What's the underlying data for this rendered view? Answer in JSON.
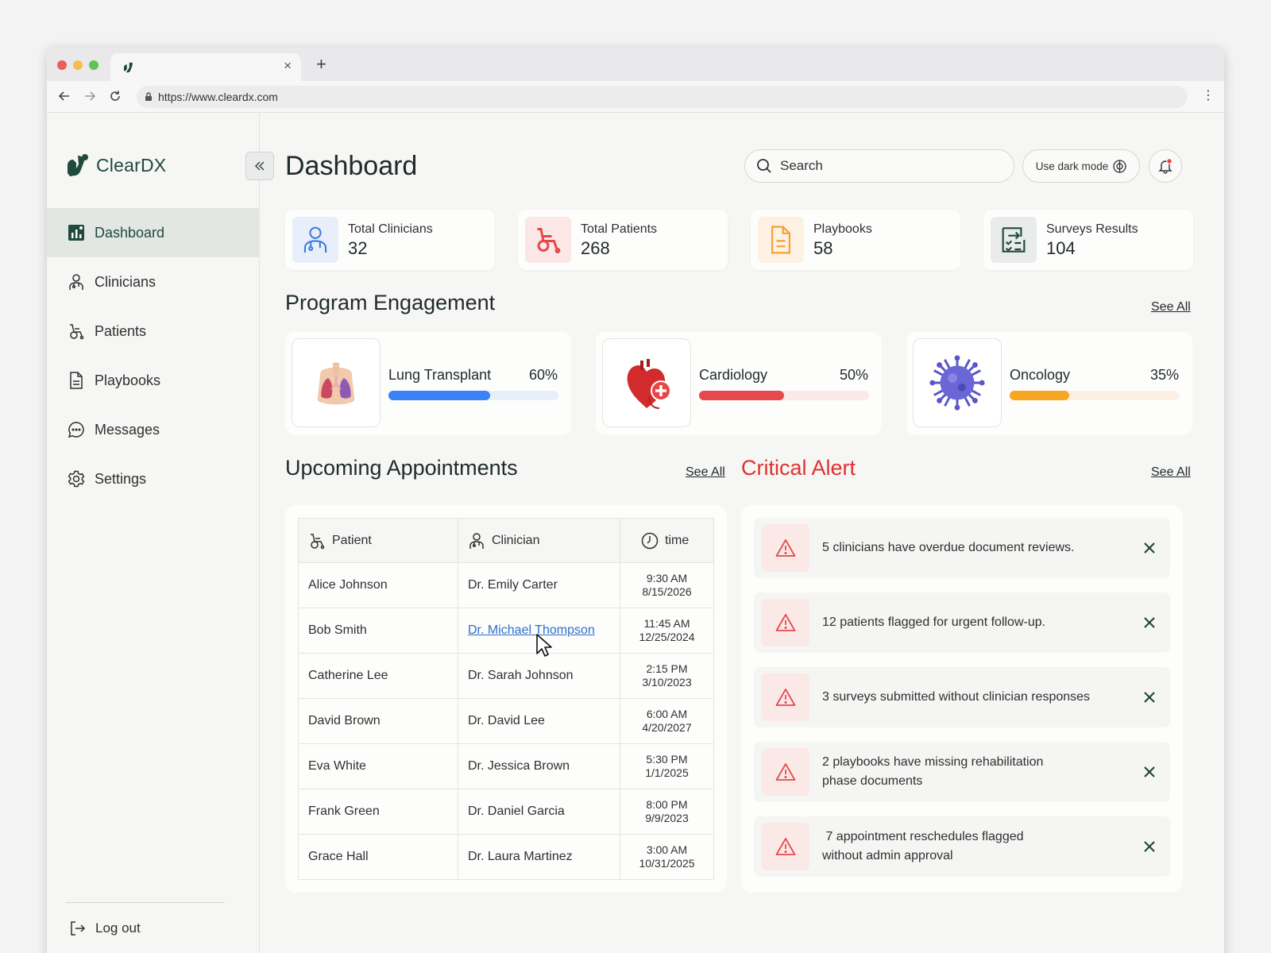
{
  "browser": {
    "url": "https://www.cleardx.com",
    "tab_close": "×",
    "new_tab": "+",
    "menu": "⋮"
  },
  "brand": {
    "name": "ClearDX",
    "accent": "#1f4a3c",
    "logo_icon": "cleardx-logo-icon"
  },
  "sidebar": {
    "items": [
      {
        "label": "Dashboard",
        "icon": "bar-chart-icon",
        "active": true
      },
      {
        "label": "Clinicians",
        "icon": "clinician-icon"
      },
      {
        "label": "Patients",
        "icon": "wheelchair-icon"
      },
      {
        "label": "Playbooks",
        "icon": "document-icon"
      },
      {
        "label": "Messages",
        "icon": "chat-bubble-icon"
      },
      {
        "label": "Settings",
        "icon": "gear-icon"
      }
    ],
    "logout": "Log out"
  },
  "header": {
    "title": "Dashboard",
    "search_placeholder": "Search",
    "dark_mode": "Use dark mode"
  },
  "stats": [
    {
      "label": "Total Clinicians",
      "value": "32",
      "icon": "clinician-icon",
      "bg": "#e8effb",
      "color": "#3b78e0"
    },
    {
      "label": "Total Patients",
      "value": "268",
      "icon": "wheelchair-icon",
      "bg": "#fbe7e6",
      "color": "#e5484d"
    },
    {
      "label": "Playbooks",
      "value": "58",
      "icon": "document-icon",
      "bg": "#fdf1e3",
      "color": "#f5a031"
    },
    {
      "label": "Surveys Results",
      "value": "104",
      "icon": "survey-checklist-icon",
      "bg": "#e9ecea",
      "color": "#1f4a3c"
    }
  ],
  "program": {
    "title": "Program Engagement",
    "see_all": "See All",
    "items": [
      {
        "name": "Lung Transplant",
        "percent": "60%",
        "value": 0.6,
        "color": "#3b82f6",
        "track": "#e8effc",
        "image": "lungs-icon"
      },
      {
        "name": "Cardiology",
        "percent": "50%",
        "value": 0.5,
        "color": "#e5484d",
        "track": "#fbe8e8",
        "image": "heart-icon"
      },
      {
        "name": "Oncology",
        "percent": "35%",
        "value": 0.35,
        "color": "#f5a623",
        "track": "#fcf0e2",
        "image": "virus-icon"
      }
    ]
  },
  "appointments": {
    "title": "Upcoming Appointments",
    "see_all": "See All",
    "columns": [
      "Patient",
      "Clinician",
      "time"
    ],
    "rows": [
      {
        "patient": "Alice Johnson",
        "clinician": "Dr. Emily Carter",
        "time": "9:30 AM",
        "date": "8/15/2026"
      },
      {
        "patient": "Bob Smith",
        "clinician": "Dr. Michael Thompson",
        "time": "11:45 AM",
        "date": "12/25/2024",
        "link": true
      },
      {
        "patient": "Catherine Lee",
        "clinician": "Dr. Sarah Johnson",
        "time": "2:15 PM",
        "date": "3/10/2023"
      },
      {
        "patient": "David Brown",
        "clinician": "Dr. David Lee",
        "time": "6:00 AM",
        "date": "4/20/2027"
      },
      {
        "patient": "Eva White",
        "clinician": "Dr. Jessica Brown",
        "time": "5:30 PM",
        "date": "1/1/2025"
      },
      {
        "patient": "Frank Green",
        "clinician": "Dr. Daniel Garcia",
        "time": "8:00 PM",
        "date": "9/9/2023"
      },
      {
        "patient": "Grace Hall",
        "clinician": "Dr. Laura Martinez",
        "time": "3:00 AM",
        "date": "10/31/2025"
      }
    ]
  },
  "alerts": {
    "title": "Critical Alert",
    "title_color": "#e03131",
    "see_all": "See All",
    "items": [
      "5 clinicians have overdue document reviews.",
      "12 patients flagged for urgent follow-up.",
      "3 surveys submitted without clinician responses",
      "2 playbooks have missing rehabilitation phase documents",
      " 7 appointment reschedules flagged without admin approval"
    ]
  }
}
